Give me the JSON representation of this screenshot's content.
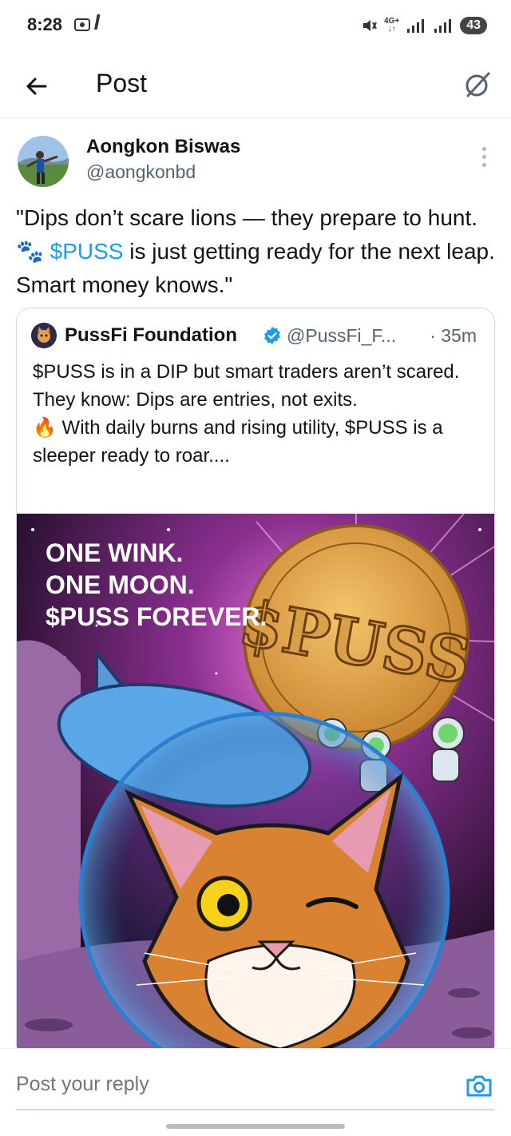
{
  "status_bar": {
    "time": "8:28",
    "network": "4G+",
    "battery": "43"
  },
  "nav": {
    "title": "Post"
  },
  "post": {
    "author_name": "Aongkon Biswas",
    "author_handle": "@aongkonbd",
    "text_part1": "\"Dips don’t scare lions — they prepare to hunt. 🐾 ",
    "cashtag": "$PUSS",
    "text_part2": " is just getting ready for the next leap. Smart money knows.\""
  },
  "quote": {
    "author_name": "PussFi Foundation",
    "author_handle": "@PussFi_F...",
    "time": "· 35m",
    "line1": "$PUSS is in a DIP but smart traders aren’t scared.",
    "line2": "They know: Dips are entries, not exits.",
    "line3": "🔥 With daily burns and rising utility, $PUSS is a sleeper ready to roar....",
    "image_text": {
      "line1": "ONE WINK.",
      "line2": "ONE MOON.",
      "line3": "$PUSS FOREVER.",
      "coin": "$PUSS"
    }
  },
  "reply": {
    "placeholder": "Post your reply"
  },
  "colors": {
    "accent": "#1d9bf0",
    "text": "#0f1419",
    "secondary": "#536471"
  },
  "icons": [
    "back-arrow-icon",
    "grok-icon",
    "more-vertical-icon",
    "verified-badge-icon",
    "camera-icon"
  ]
}
